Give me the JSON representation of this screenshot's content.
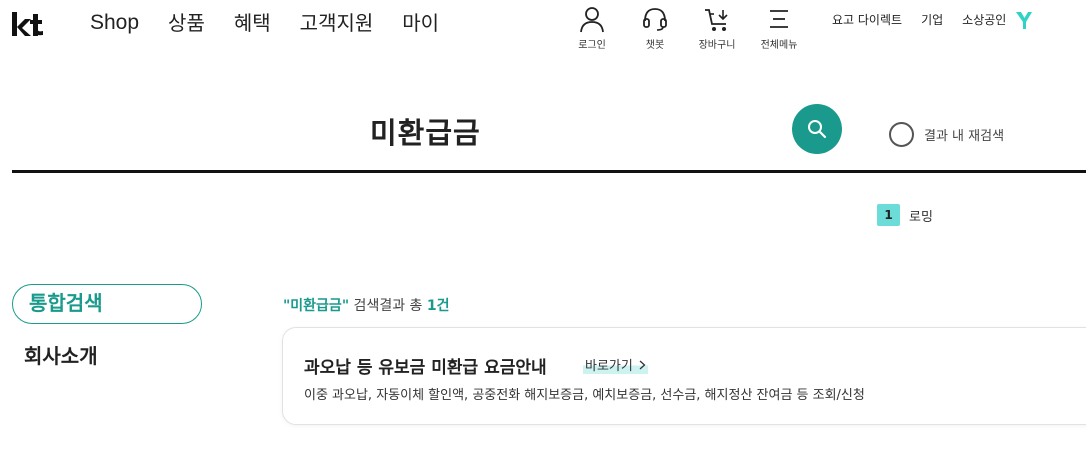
{
  "header": {
    "logo_icon": "kt-logo-icon",
    "nav": [
      "Shop",
      "상품",
      "혜택",
      "고객지원",
      "마이"
    ],
    "utility": [
      {
        "label": "로그인",
        "icon": "person-icon"
      },
      {
        "label": "챗봇",
        "icon": "headset-icon"
      },
      {
        "label": "장바구니",
        "icon": "cart-icon"
      },
      {
        "label": "전체메뉴",
        "icon": "menu-icon"
      }
    ],
    "top_links": [
      "요고 다이렉트",
      "기업",
      "소상공인"
    ],
    "brand_icon": "y-logo-icon"
  },
  "search": {
    "term": "미환급금",
    "button_icon": "search-icon",
    "research_label": "결과 내 재검색"
  },
  "popular": {
    "rank": "1",
    "keyword": "로밍"
  },
  "sidebar": {
    "active_tab": "통합검색",
    "tabs": [
      "회사소개"
    ]
  },
  "results": {
    "query_quoted": "\"미환급금\"",
    "summary_mid": " 검색결과 총 ",
    "count": "1건",
    "items": [
      {
        "title": "과오납 등 유보금 미환급 요금안내",
        "link_label": "바로가기",
        "description": "이중 과오납, 자동이체 할인액, 공중전화 해지보증금, 예치보증금, 선수금, 해지정산 잔여금 등 조회/신청"
      }
    ]
  },
  "colors": {
    "accent": "#1a9a8c",
    "rank_badge": "#6cdcd8",
    "link_highlight": "#cdf3f1"
  }
}
